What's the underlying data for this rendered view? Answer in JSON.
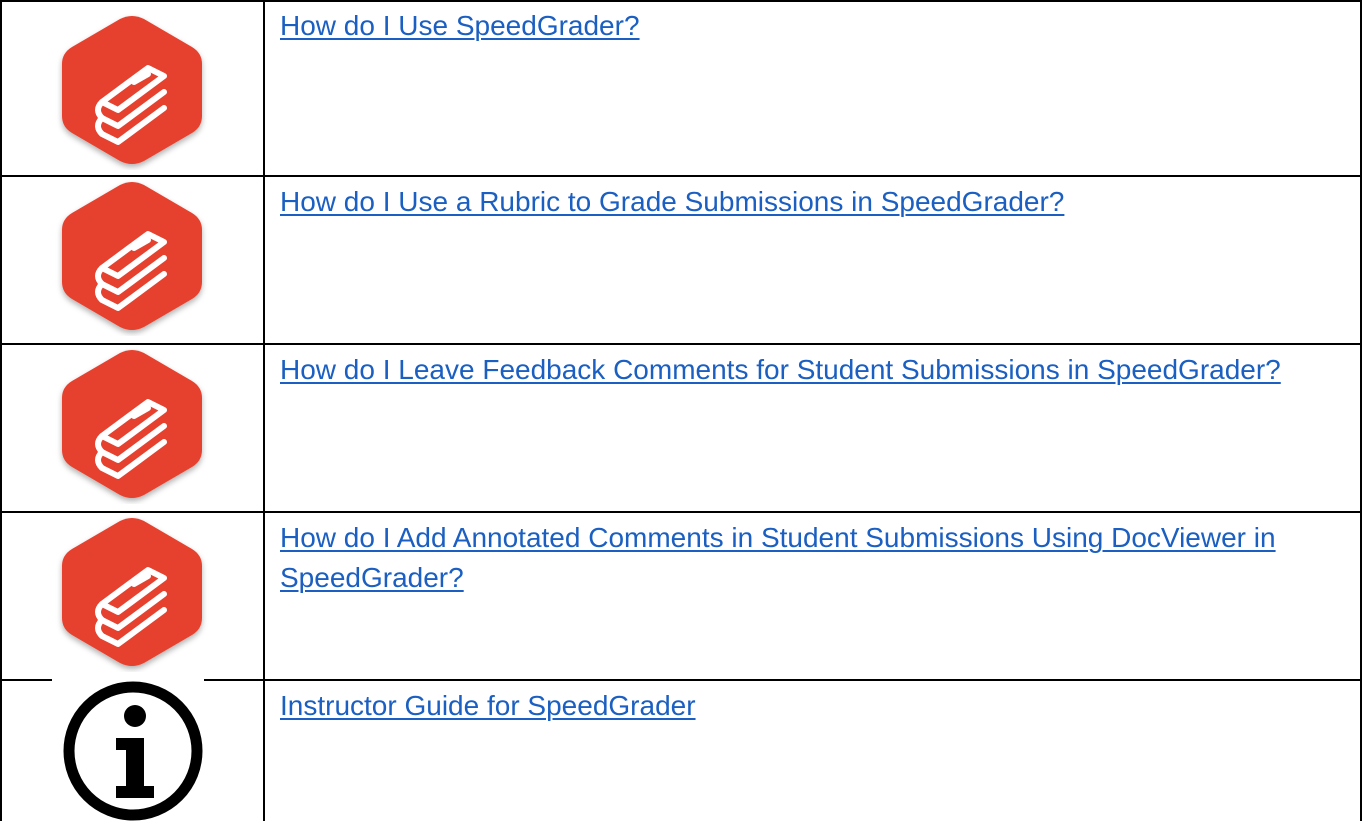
{
  "links": [
    {
      "label": "How do I Use SpeedGrader?",
      "icon": "book-stack-icon"
    },
    {
      "label": "How do I Use a Rubric to Grade Submissions in SpeedGrader?",
      "icon": "book-stack-icon"
    },
    {
      "label": "How do I Leave Feedback Comments for Student Submissions in SpeedGrader?",
      "icon": "book-stack-icon"
    },
    {
      "label": "How do I Add Annotated Comments in Student Submissions Using DocViewer in SpeedGrader?",
      "icon": "book-stack-icon"
    },
    {
      "label": "Instructor Guide for SpeedGrader",
      "icon": "info-icon"
    }
  ],
  "colors": {
    "link": "#1a5fc1",
    "hexagon": "#e6402e",
    "border": "#000000"
  }
}
